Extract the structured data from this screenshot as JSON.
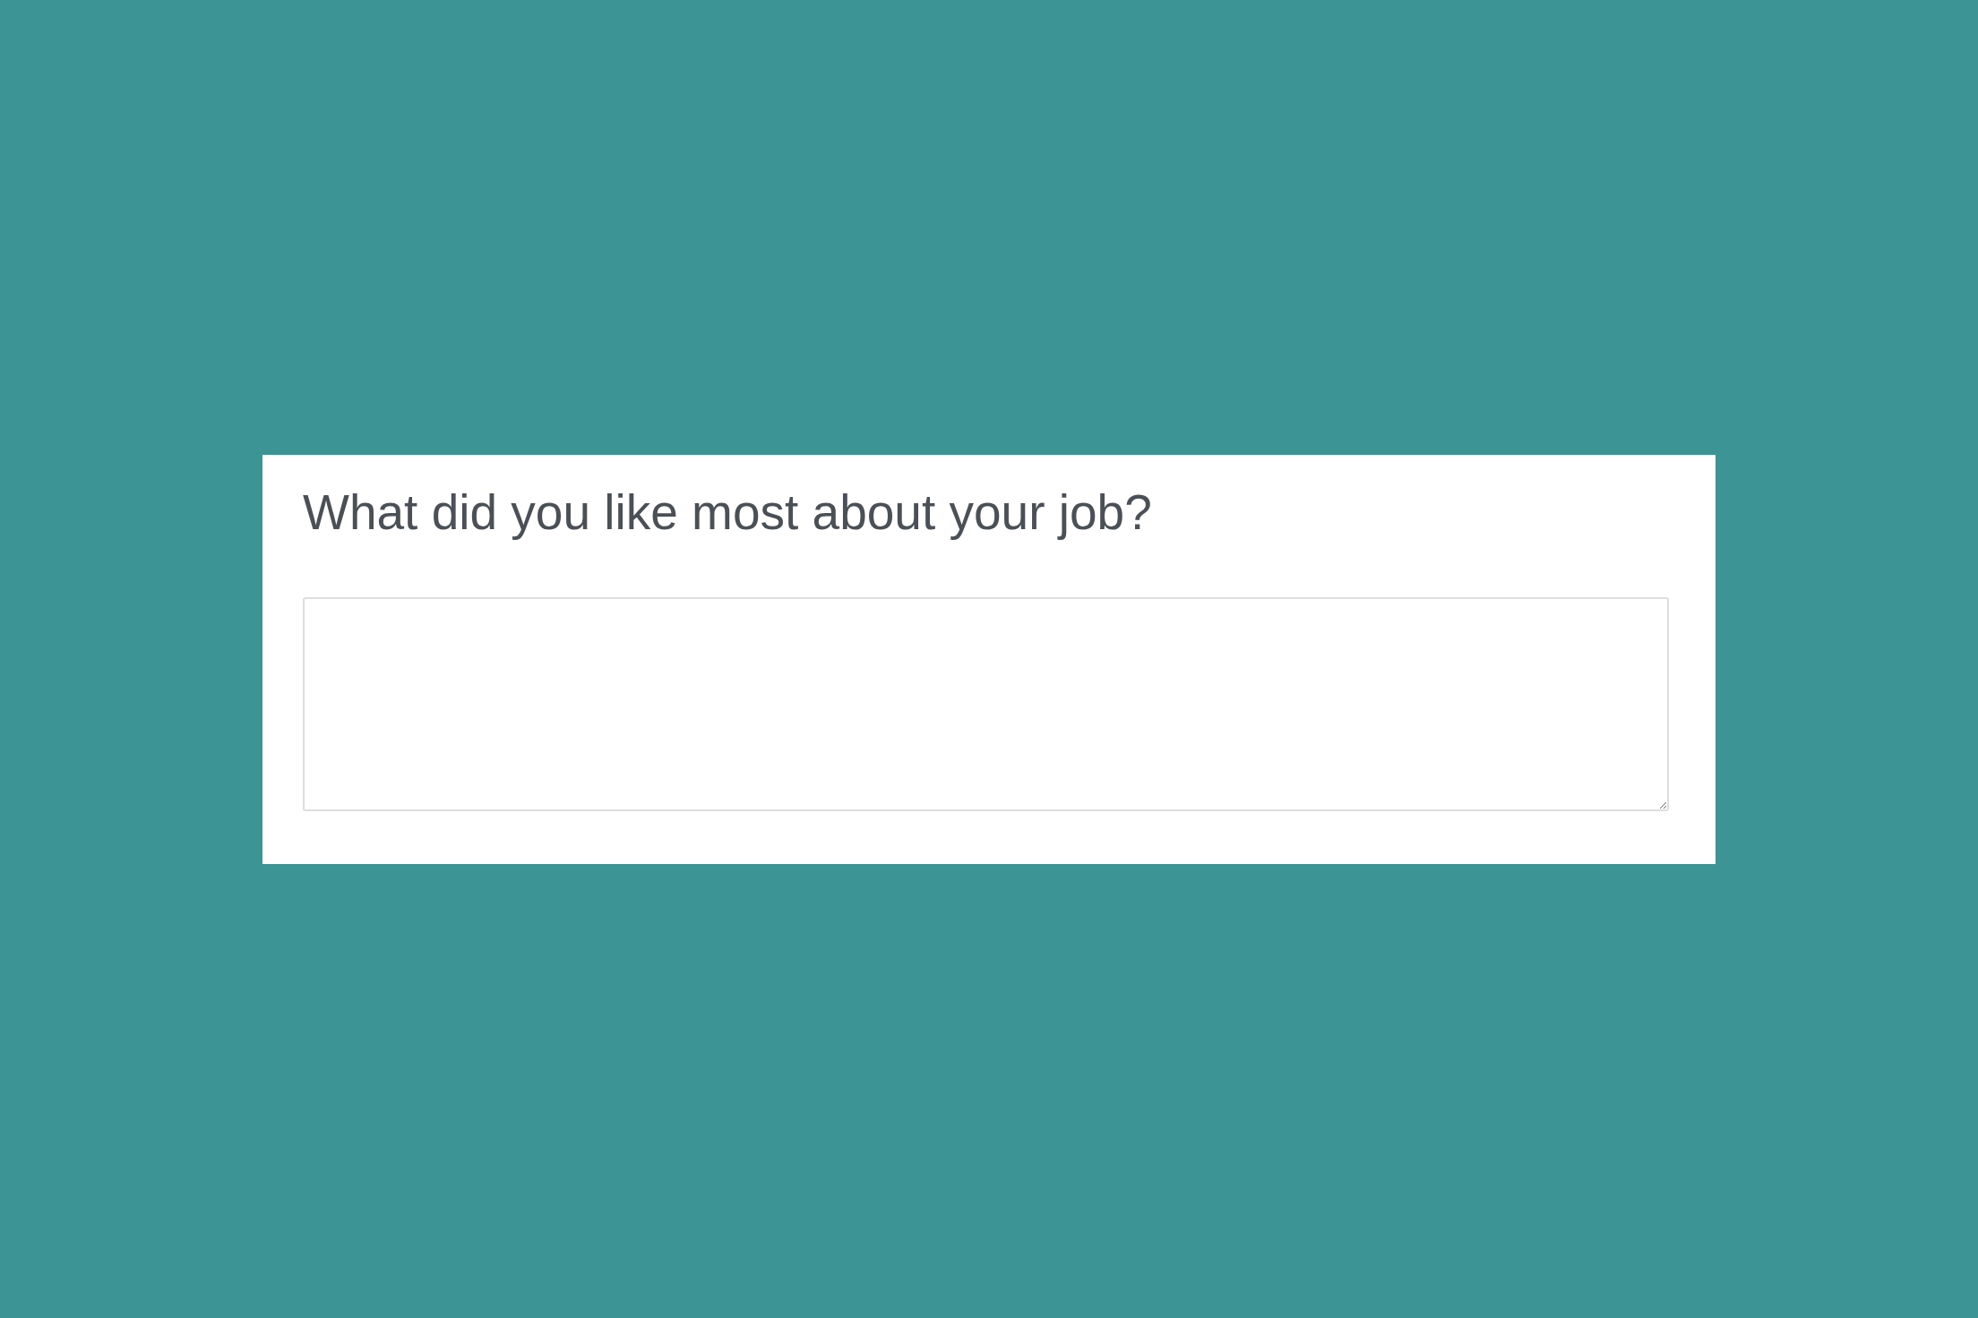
{
  "question_card": {
    "question": "What did you like most about your job?",
    "answer_field": {
      "resizable": true
    }
  }
}
